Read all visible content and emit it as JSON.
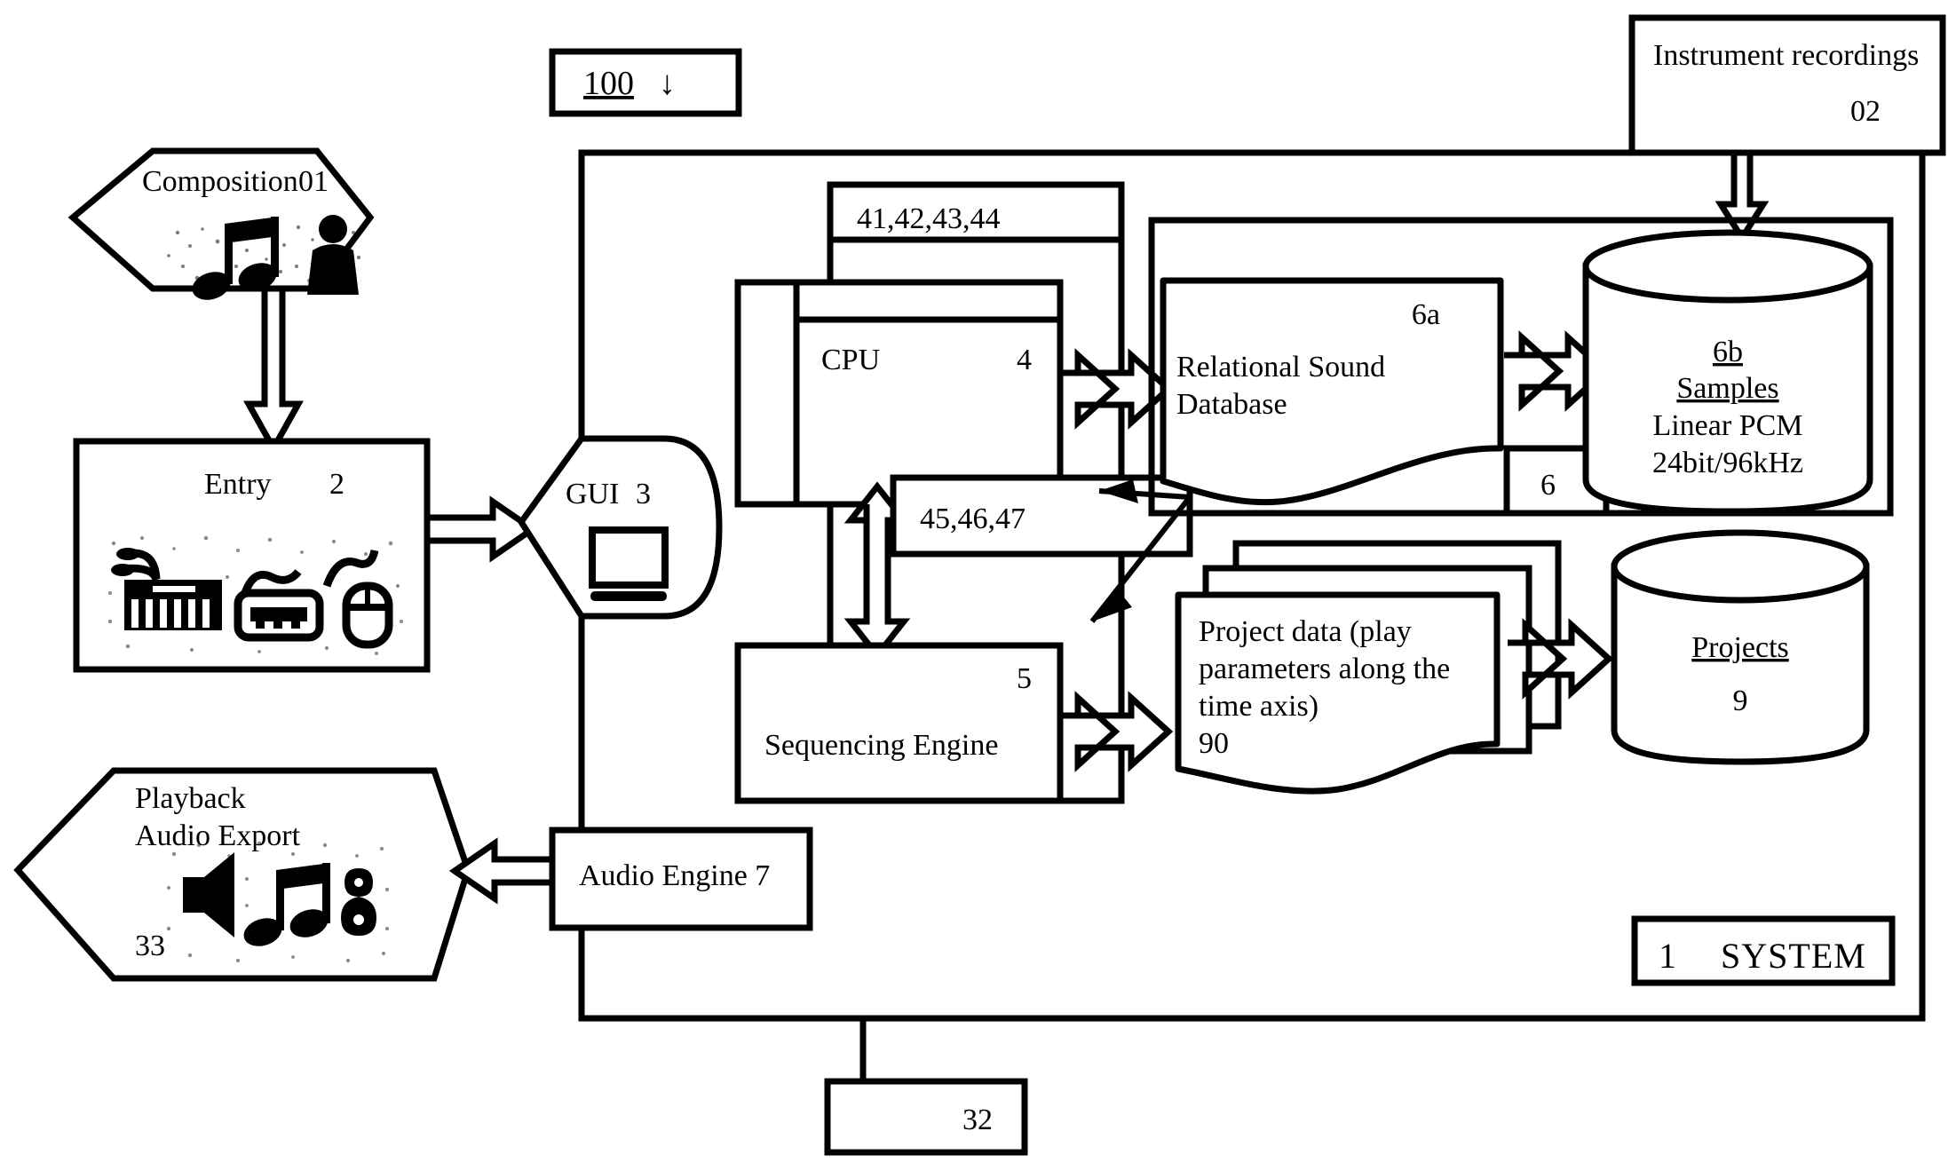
{
  "figure": {
    "ref_box": {
      "label": "100",
      "arrow": "↓"
    },
    "system_box": {
      "number": "1",
      "label": "SYSTEM"
    },
    "bottom_box": {
      "label": "32"
    }
  },
  "nodes": {
    "composition": {
      "title": "Composition",
      "ref": "01",
      "icon": "music-people-clipart"
    },
    "instrument_recordings": {
      "title": "Instrument recordings",
      "ref": "02"
    },
    "entry": {
      "title": "Entry",
      "ref": "2",
      "icon": "keyboard-midi-mouse-clipart"
    },
    "gui": {
      "title": "GUI",
      "ref": "3",
      "icon": "monitor-icon"
    },
    "playback": {
      "line1": "Playback",
      "line2": "Audio Export",
      "ref": "33",
      "icon": "speaker-music-clipart"
    },
    "audio_engine": {
      "title": "Audio Engine 7"
    },
    "bus_top": {
      "label": "41,42,43,44"
    },
    "bus_mid": {
      "label": "45,46,47"
    },
    "cpu": {
      "title": "CPU",
      "ref": "4"
    },
    "sequencing_engine": {
      "title": "Sequencing Engine",
      "ref": "5"
    },
    "rel_sound_db": {
      "line1": "Relational Sound",
      "line2": "Database",
      "ref": "6a"
    },
    "sound_db_group": {
      "ref": "6"
    },
    "samples": {
      "ref": "6b",
      "title": "Samples",
      "line1": "Linear PCM",
      "line2": "24bit/96kHz"
    },
    "project_data": {
      "line1": "Project data (play",
      "line2": "parameters along the",
      "line3": "time axis)",
      "ref": "90"
    },
    "projects": {
      "title": "Projects",
      "ref": "9"
    }
  },
  "colors": {
    "stroke": "#000000",
    "fill": "#ffffff"
  }
}
